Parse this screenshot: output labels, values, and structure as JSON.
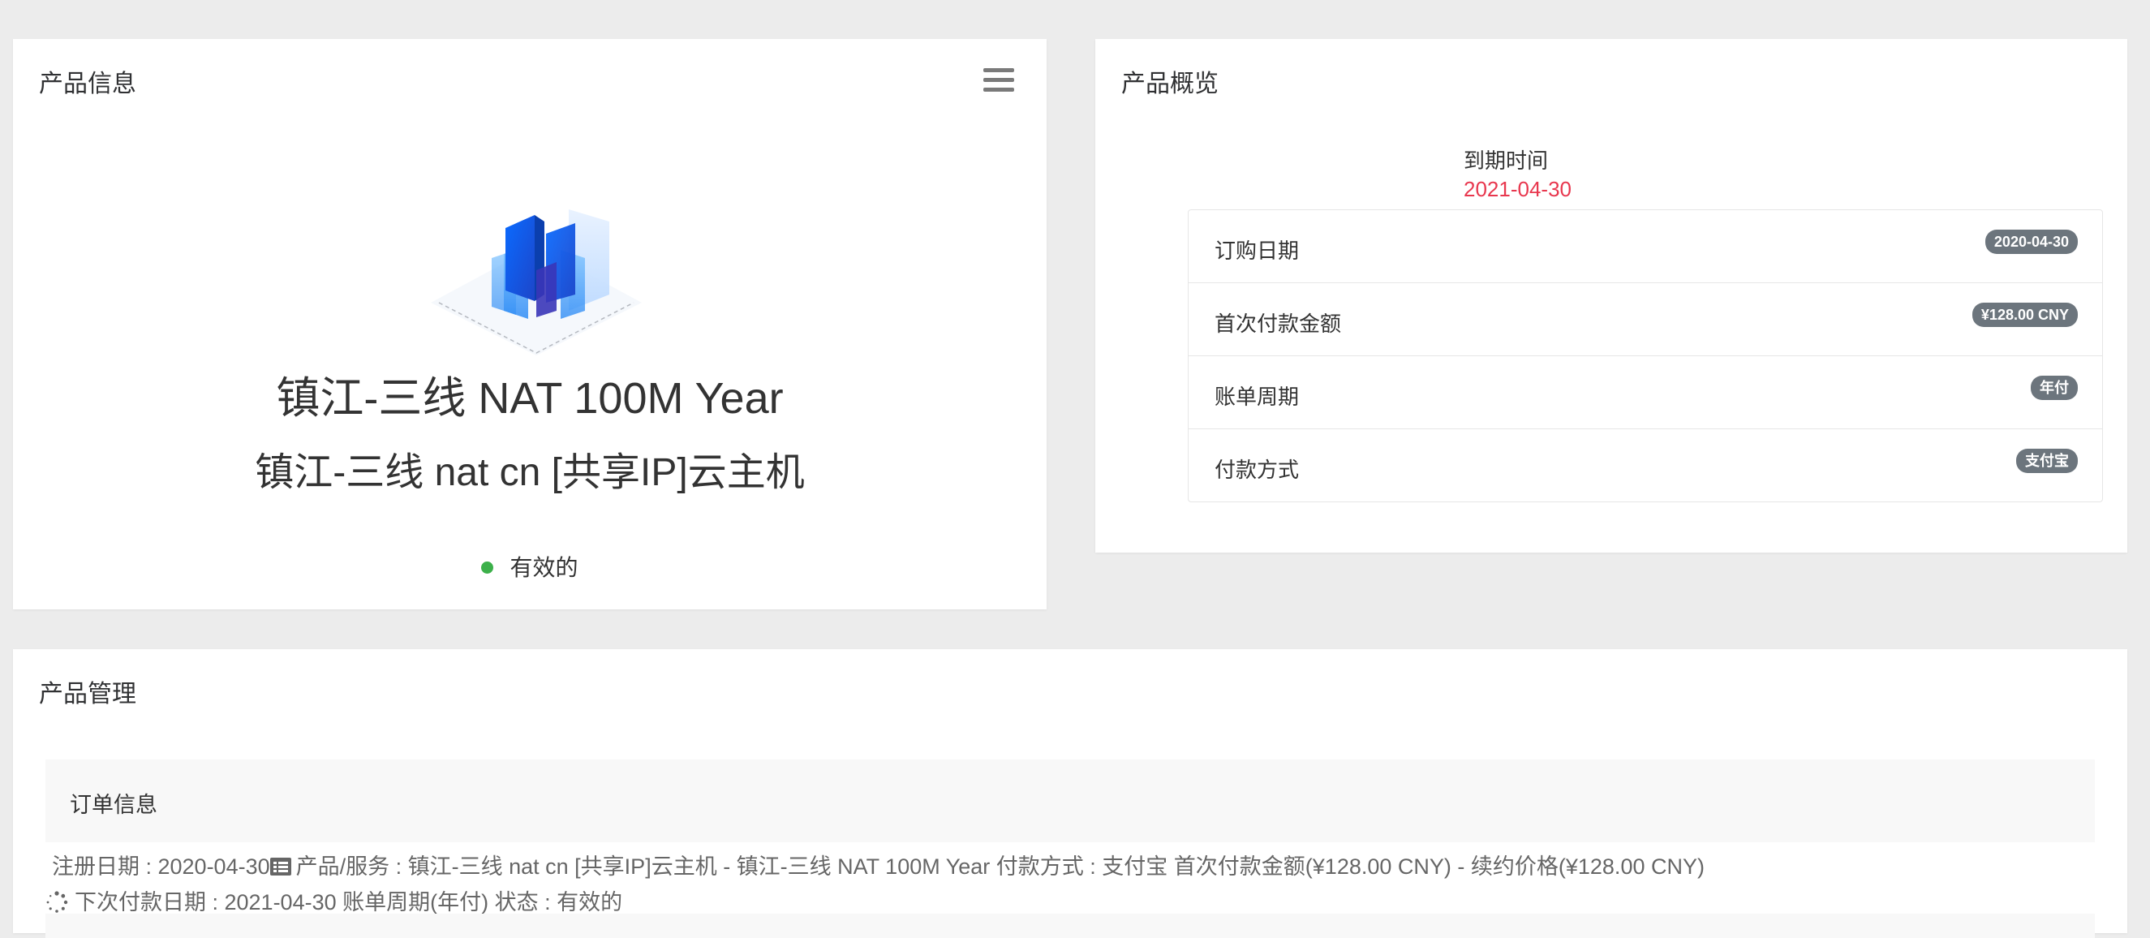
{
  "product_info": {
    "title": "产品信息",
    "product_name": "镇江-三线 NAT 100M Year",
    "product_group": "镇江-三线 nat cn [共享IP]云主机",
    "status": "有效的"
  },
  "overview": {
    "title": "产品概览",
    "expire_label": "到期时间",
    "expire_value": "2021-04-30",
    "rows": [
      {
        "label": "订购日期",
        "badge": "2020-04-30"
      },
      {
        "label": "首次付款金额",
        "badge": "¥128.00 CNY"
      },
      {
        "label": "账单周期",
        "badge": "年付"
      },
      {
        "label": "付款方式",
        "badge": "支付宝"
      }
    ]
  },
  "management": {
    "title": "产品管理",
    "order_title": "订单信息",
    "line1_a": "注册日期 : 2020-04-30",
    "line1_b": "产品/服务 : 镇江-三线 nat cn [共享IP]云主机 - 镇江-三线 NAT 100M Year 付款方式 : 支付宝 首次付款金额(¥128.00 CNY) - 续约价格(¥128.00 CNY)",
    "line2": "下次付款日期 : 2021-04-30 账单周期(年付) 状态 : 有效的"
  },
  "icons": {
    "menu": "hamburger-menu-icon",
    "status": "status-dot-icon",
    "list": "list-icon",
    "spinner": "spinner-icon"
  },
  "colors": {
    "page_bg": "#ececec",
    "expire_red": "#e8374e",
    "status_green": "#3cb04a",
    "badge_gray": "#6c757d"
  }
}
